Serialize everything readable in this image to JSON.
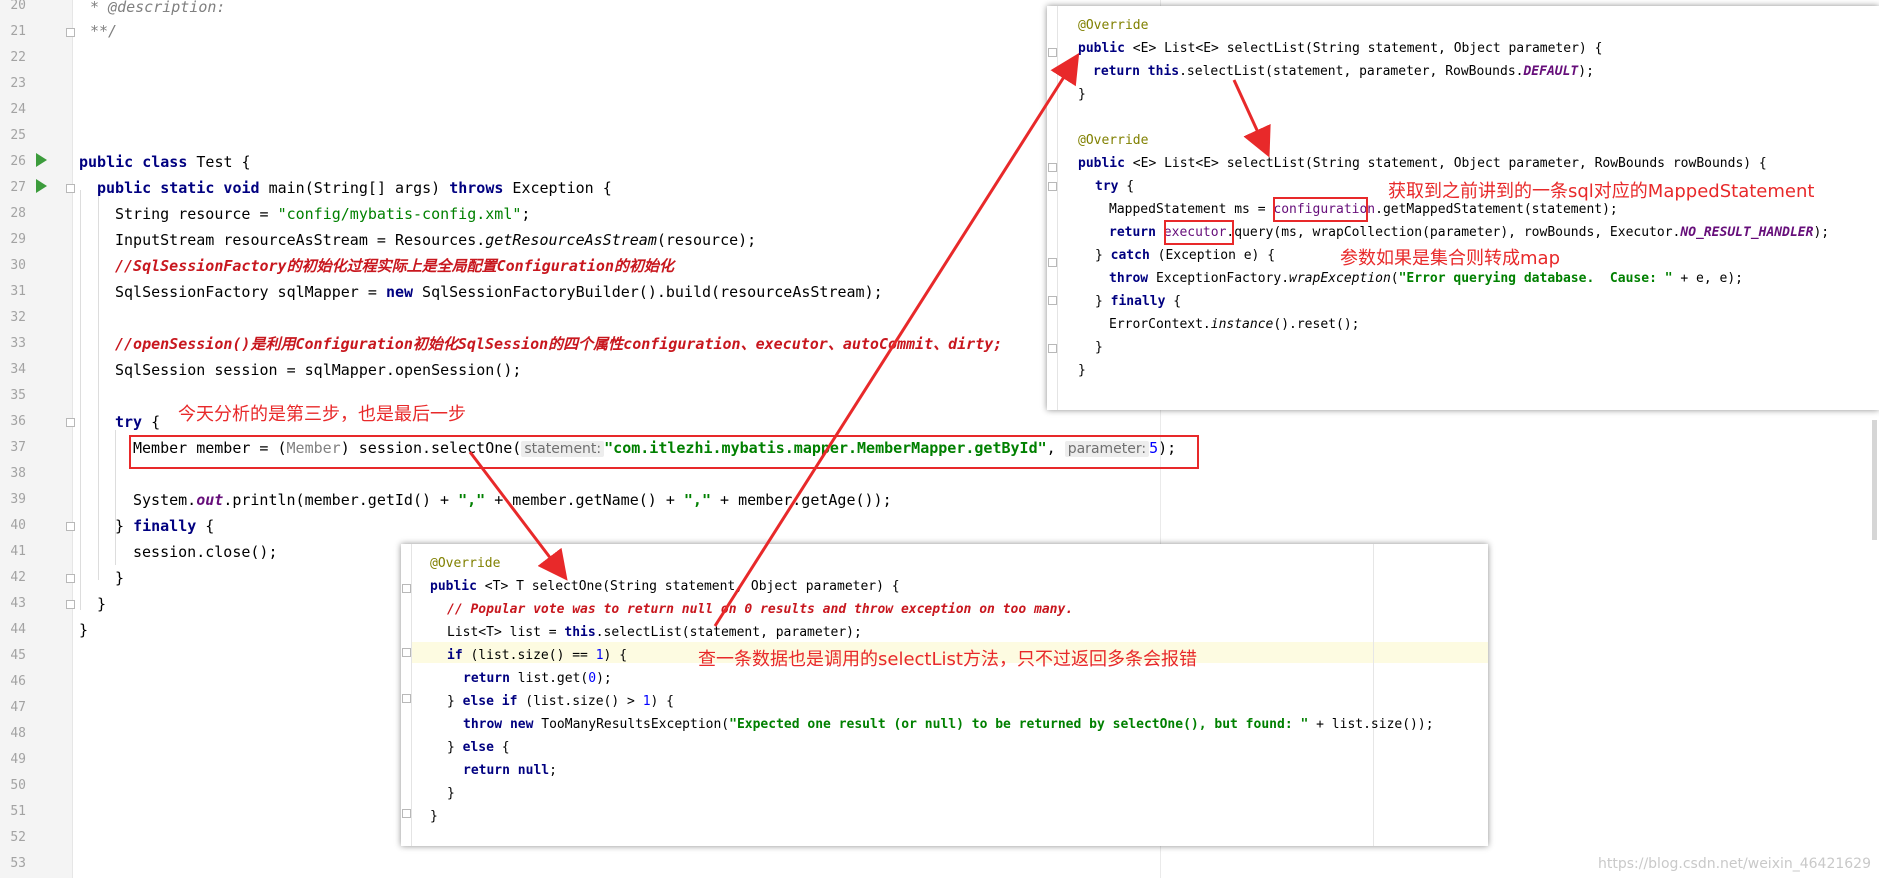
{
  "main": {
    "line_numbers": [
      "20",
      "21",
      "22",
      "23",
      "24",
      "25",
      "26",
      "27",
      "28",
      "29",
      "30",
      "31",
      "32",
      "33",
      "34",
      "35",
      "36",
      "37",
      "38",
      "39",
      "40",
      "41",
      "42",
      "43",
      "44",
      "45",
      "46",
      "47",
      "48",
      "49",
      "50",
      "51",
      "52",
      "53"
    ],
    "lines": {
      "l20": "* @description:",
      "l21": "**/",
      "l26_a": "public class",
      "l26_b": " Test {",
      "l27_a": "public static void",
      "l27_b": " main(String[] args) ",
      "l27_c": "throws",
      "l27_d": " Exception {",
      "l28_a": "String resource = ",
      "l28_b": "\"config/mybatis-config.xml\"",
      "l28_c": ";",
      "l29_a": "InputStream resourceAsStream = Resources.",
      "l29_b": "getResourceAsStream",
      "l29_c": "(resource);",
      "l30": "//SqlSessionFactory的初始化过程实际上是全局配置Configuration的初始化",
      "l31_a": "SqlSessionFactory sqlMapper = ",
      "l31_b": "new",
      "l31_c": " SqlSessionFactoryBuilder().build(resourceAsStream);",
      "l33": "//openSession()是利用Configuration初始化SqlSession的四个属性configuration、executor、autoCommit、dirty;",
      "l34": "SqlSession session = sqlMapper.openSession();",
      "l36_a": "try",
      "l36_b": " {",
      "l37_a": "Member member = (",
      "l37_b": "Member",
      "l37_c": ") session.selectOne(",
      "l37_hint1": "statement:",
      "l37_d": "\"com.itlezhi.mybatis.mapper.MemberMapper.getById\"",
      "l37_e": ", ",
      "l37_hint2": "parameter:",
      "l37_f": "5",
      "l37_g": ");",
      "l39_a": "System.",
      "l39_b": "out",
      "l39_c": ".println(member.getId() + ",
      "l39_d": "\",\"",
      "l39_e": " + member.getName() + ",
      "l39_f": "\",\"",
      "l39_g": " + member.getAge());",
      "l40_a": "} ",
      "l40_b": "finally",
      "l40_c": " {",
      "l41": "session.close();",
      "l42": "}",
      "l43": "}",
      "l44": "}"
    }
  },
  "popup_top": {
    "lines": {
      "p1": "@Override",
      "p2_a": "public",
      "p2_b": " <E> List<E> selectList(String statement, Object parameter) {",
      "p3_a": "return this",
      "p3_b": ".selectList(statement, parameter, RowBounds.",
      "p3_c": "DEFAULT",
      "p3_d": ");",
      "p4": "}",
      "p6": "@Override",
      "p7_a": "public",
      "p7_b": " <E> List<E> selectList(String statement, Object parameter, RowBounds rowBounds) {",
      "p8_a": "try",
      "p8_b": " {",
      "p9_a": "MappedStatement ms = ",
      "p9_b": "configuration",
      "p9_c": ".getMappedStatement(statement);",
      "p10_a": "return",
      "p10_b": " executor",
      "p10_c": ".query(ms, wrapCollection(parameter), rowBounds, Executor.",
      "p10_d": "NO_RESULT_HANDLER",
      "p10_e": ");",
      "p11_a": "} ",
      "p11_b": "catch",
      "p11_c": " (Exception e) {",
      "p12_a": "throw",
      "p12_b": " ExceptionFactory.",
      "p12_c": "wrapException",
      "p12_d": "(",
      "p12_e": "\"Error querying database.  Cause: \"",
      "p12_f": " + e, e);",
      "p13_a": "} ",
      "p13_b": "finally",
      "p13_c": " {",
      "p14_a": "ErrorContext.",
      "p14_b": "instance",
      "p14_c": "().reset();",
      "p15": "}",
      "p16": "}"
    }
  },
  "popup_bottom": {
    "lines": {
      "b1": "@Override",
      "b2_a": "public",
      "b2_b": " <T> T selectOne(String statement, Object parameter) {",
      "b3": "// Popular vote was to return null on 0 results and throw exception on too many.",
      "b4_a": "List<T> list = ",
      "b4_b": "this",
      "b4_c": ".selectList(statement, parameter);",
      "b5_a": "if",
      "b5_b": " (list.size() == ",
      "b5_c": "1",
      "b5_d": ") {",
      "b6_a": "return",
      "b6_b": " list.get(",
      "b6_c": "0",
      "b6_d": ");",
      "b7_a": "} ",
      "b7_b": "else if",
      "b7_c": " (list.size() > ",
      "b7_d": "1",
      "b7_e": ") {",
      "b8_a": "throw new",
      "b8_b": " TooManyResultsException(",
      "b8_c": "\"Expected one result (or null) to be returned by selectOne(), but found: \"",
      "b8_d": " + list.size());",
      "b9_a": "} ",
      "b9_b": "else",
      "b9_c": " {",
      "b10_a": "return null",
      "b10_b": ";",
      "b11": "}",
      "b12": "}"
    }
  },
  "annotations": {
    "step_note": "今天分析的是第三步，也是最后一步",
    "mapped_statement_note": "获取到之前讲到的一条sql对应的MappedStatement",
    "collection_note": "参数如果是集合则转成map",
    "selectone_note": "查一条数据也是调用的selectList方法，只不过返回多条会报错"
  },
  "watermark": "https://blog.csdn.net/weixin_46421629",
  "colors": {
    "annotation_red": "#e8292a",
    "keyword": "#000080",
    "string": "#008000"
  }
}
